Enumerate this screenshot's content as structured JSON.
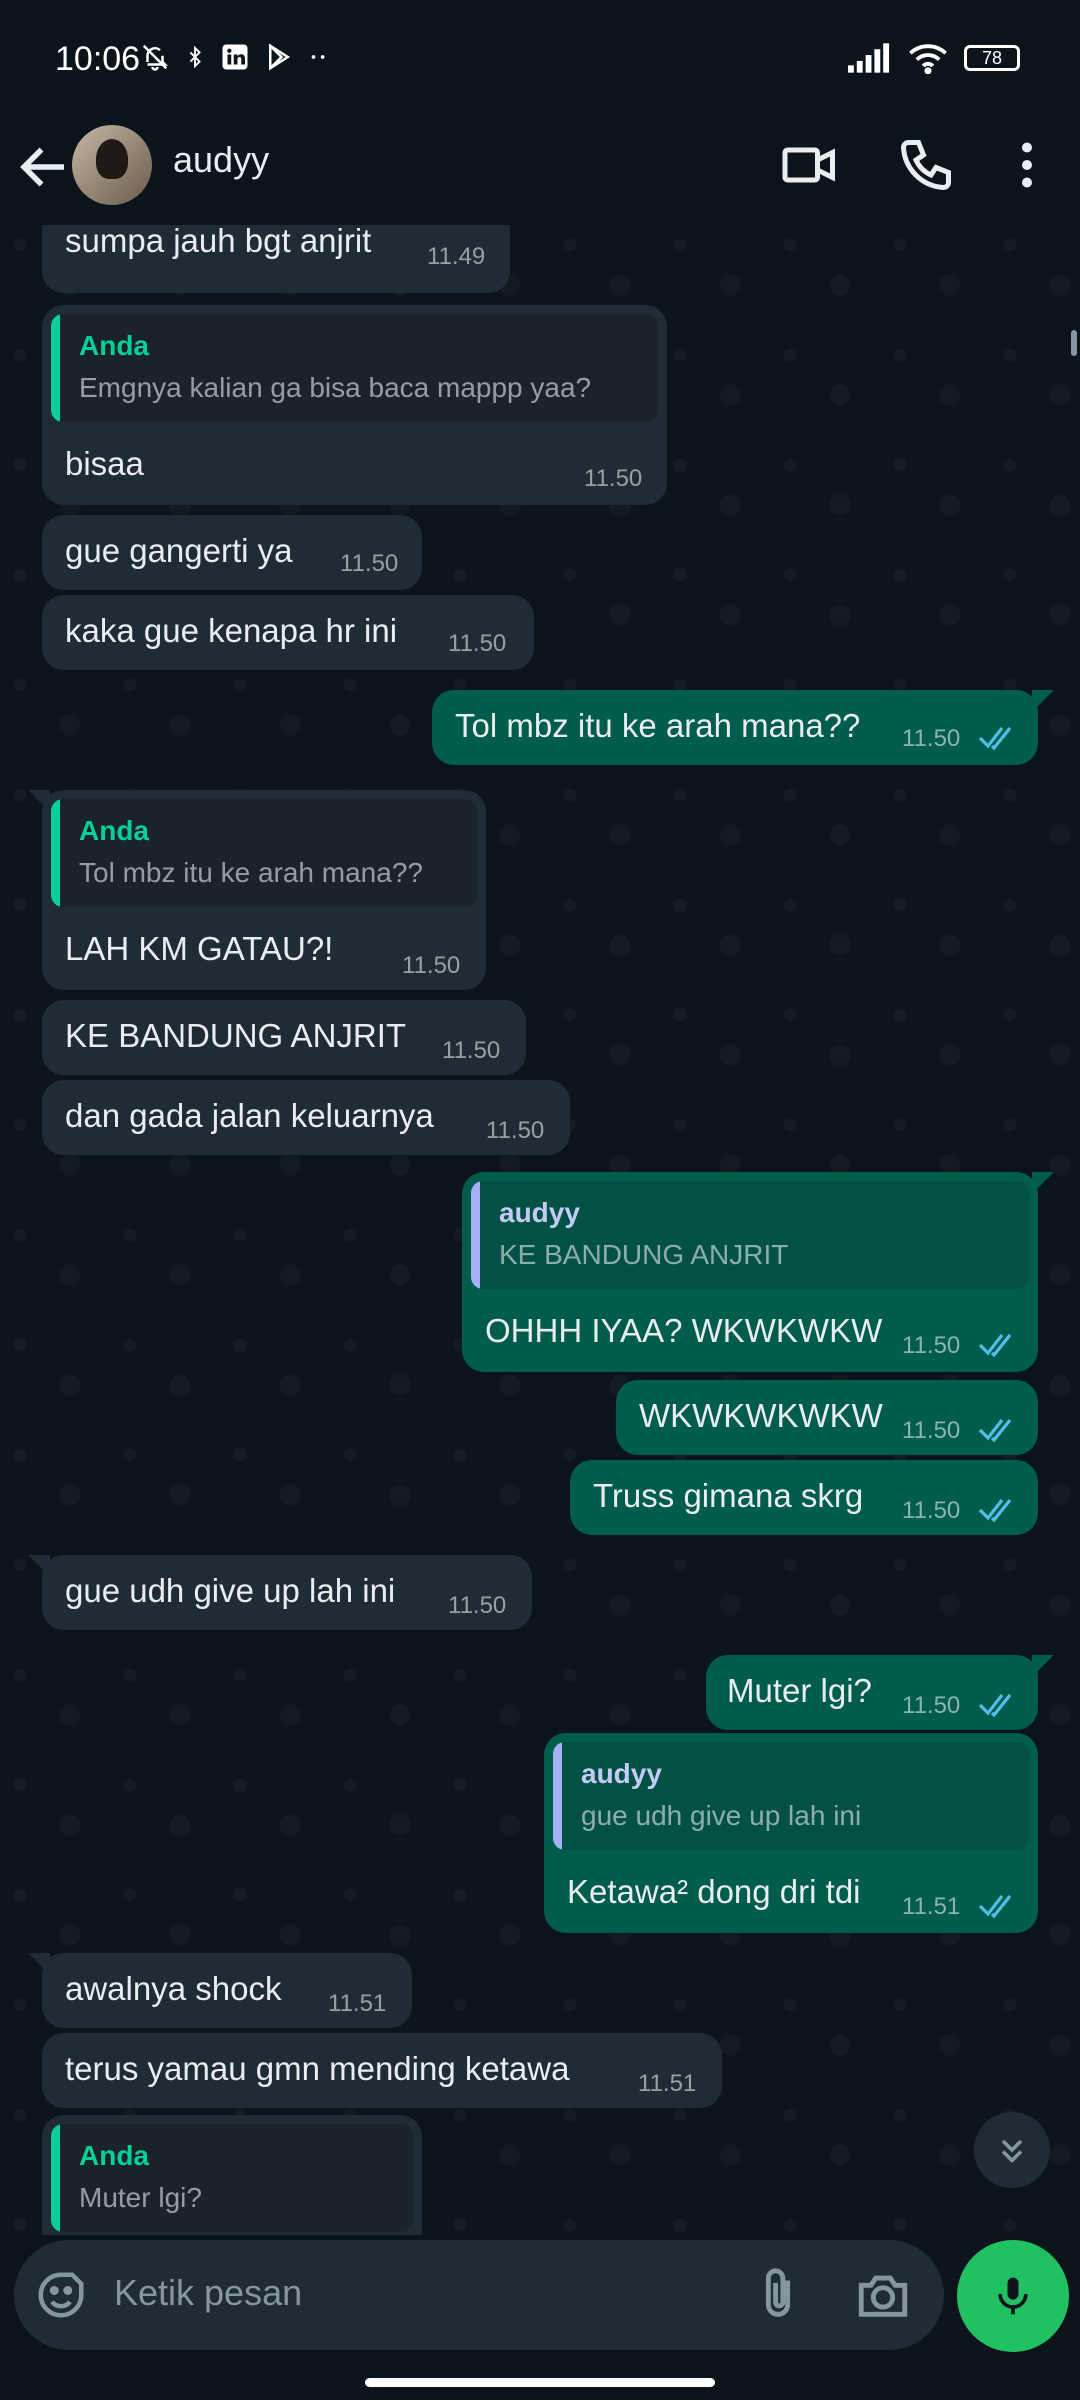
{
  "status_bar": {
    "time": "10:06",
    "battery": "78"
  },
  "header": {
    "contact_name": "audyy"
  },
  "colors": {
    "outgoing_bubble": "#005c4b",
    "incoming_bubble": "#202c33",
    "accent_green": "#21c063",
    "quote_anda": "#06cf9c",
    "quote_audyy": "#a5b0f5",
    "read_ticks": "#53bdeb"
  },
  "messages": [
    {
      "dir": "in",
      "text": "sumpa jauh bgt anjrit",
      "time": "11.49"
    },
    {
      "dir": "in",
      "quote_name": "Anda",
      "quote_text": "Emgnya kalian ga bisa baca mappp yaa?",
      "text": "bisaa",
      "time": "11.50"
    },
    {
      "dir": "in",
      "text": "gue gangerti ya",
      "time": "11.50"
    },
    {
      "dir": "in",
      "text": "kaka gue kenapa hr ini",
      "time": "11.50"
    },
    {
      "dir": "out",
      "text": "Tol mbz itu ke arah mana??",
      "time": "11.50"
    },
    {
      "dir": "in",
      "quote_name": "Anda",
      "quote_text": "Tol mbz itu ke arah mana??",
      "text": "LAH KM GATAU?!",
      "time": "11.50"
    },
    {
      "dir": "in",
      "text": "KE BANDUNG ANJRIT",
      "time": "11.50"
    },
    {
      "dir": "in",
      "text": "dan gada jalan keluarnya",
      "time": "11.50"
    },
    {
      "dir": "out",
      "quote_name": "audyy",
      "quote_text": "KE BANDUNG ANJRIT",
      "text": "OHHH IYAA? WKWKWKW",
      "time": "11.50"
    },
    {
      "dir": "out",
      "text": "WKWKWKWKW",
      "time": "11.50"
    },
    {
      "dir": "out",
      "text": "Truss gimana skrg",
      "time": "11.50"
    },
    {
      "dir": "in",
      "text": "gue udh give up lah ini",
      "time": "11.50"
    },
    {
      "dir": "out",
      "text": "Muter lgi?",
      "time": "11.50"
    },
    {
      "dir": "out",
      "quote_name": "audyy",
      "quote_text": "gue udh give up lah ini",
      "text": "Ketawa² dong dri tdi",
      "time": "11.51"
    },
    {
      "dir": "in",
      "text": "awalnya shock",
      "time": "11.51"
    },
    {
      "dir": "in",
      "text": "terus yamau gmn mending ketawa",
      "time": "11.51"
    },
    {
      "dir": "in",
      "quote_name": "Anda",
      "quote_text": "Muter lgi?",
      "text": "",
      "time": ""
    }
  ],
  "composer": {
    "placeholder": "Ketik pesan"
  }
}
